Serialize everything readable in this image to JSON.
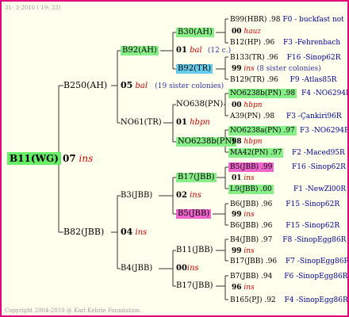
{
  "header": "31- 3-2010 ( 19: 33)",
  "footer": "Copyright 2004-2010 @ Karl Kehrle Foundation.",
  "colors": {
    "frame": "#e0007a",
    "green_highlight": "#88ee88",
    "cyan_highlight": "#66ccee",
    "pink_highlight": "#ee66cc",
    "code_blue": "#000099",
    "label_red": "#cc0000"
  },
  "gen1": {
    "name": "B11(WG)",
    "year": "07",
    "label": "ins"
  },
  "gen2": [
    {
      "name": "B250(AH)",
      "year": "05",
      "label": "bal",
      "note": "(19 sister colonies)"
    },
    {
      "name": "B82(JBB)",
      "year": "04",
      "label": "ins"
    }
  ],
  "gen3": [
    {
      "name": "B92(AH)"
    },
    {
      "name": "NO61(TR)"
    },
    {
      "name": "B3(JBB)"
    },
    {
      "name": "B4(JBB)"
    }
  ],
  "gen4": [
    {
      "name": "B30(AH)"
    },
    {
      "year": "01",
      "label": "bal",
      "note": "(12 c.)"
    },
    {
      "name": "B92(TR)"
    },
    {
      "name": "NO638(PN)"
    },
    {
      "year": "01",
      "label": "hbpn"
    },
    {
      "name": "NO6238b(PN)"
    },
    {
      "name": "B17(JBB)"
    },
    {
      "year": "02",
      "label": "ins"
    },
    {
      "name": "B5(JBB)"
    },
    {
      "name": "B11(JBB)"
    },
    {
      "year": "00",
      "label": "ins"
    },
    {
      "name": "B17(JBB)"
    }
  ],
  "gen5": [
    {
      "text": "B99(HBR) .98",
      "code": "F0 - buckfast not"
    },
    {
      "year": "00",
      "label": "hauz"
    },
    {
      "text": "B12(HP) .96",
      "code": "F3 -Fehrenbach"
    },
    {
      "text": "B133(TR) .96",
      "code": "F16 -Sinop62R"
    },
    {
      "year": "99",
      "label": "ins",
      "note": "(8 sister colonies)"
    },
    {
      "text": "B129(TR) .96",
      "code": "F9 -Atlas85R"
    },
    {
      "text": "NO6238b(PN) .98",
      "code": "F4 -NO6294R"
    },
    {
      "year": "00",
      "label": "hbpn"
    },
    {
      "text": "A39(PN) .98",
      "code": "F3 -Çankiri96R"
    },
    {
      "text": "NO6238a(PN) .97",
      "code": "F3 -NO6294R"
    },
    {
      "year": "98",
      "label": "hbpn"
    },
    {
      "text": "MA42(PN) .97",
      "code": "F2 -Maced95R"
    },
    {
      "text": "B5(JBB) .99",
      "code": "F16 -Sinop62R"
    },
    {
      "year": "01",
      "label": "ins"
    },
    {
      "text": "L9(JBB) .00",
      "code": "F1 -NewZl00R"
    },
    {
      "text": "B6(JBB) .96",
      "code": "F15 -Sinop62R"
    },
    {
      "year": "99",
      "label": "ins"
    },
    {
      "text": "B6(JBB) .96",
      "code": "F15 -Sinop62R"
    },
    {
      "text": "B4(JBB) .97",
      "code": "F8 -SinopEgg86R"
    },
    {
      "year": "99",
      "label": "ins"
    },
    {
      "text": "B17(JBB) .96",
      "code": "F7 -SinopEgg86R"
    },
    {
      "text": "B7(JBB) .94",
      "code": "F6 -SinopEgg86R"
    },
    {
      "year": "96",
      "label": "ins"
    },
    {
      "text": "B165(PJ) .92",
      "code": "F4 -SinopEgg86R"
    }
  ]
}
